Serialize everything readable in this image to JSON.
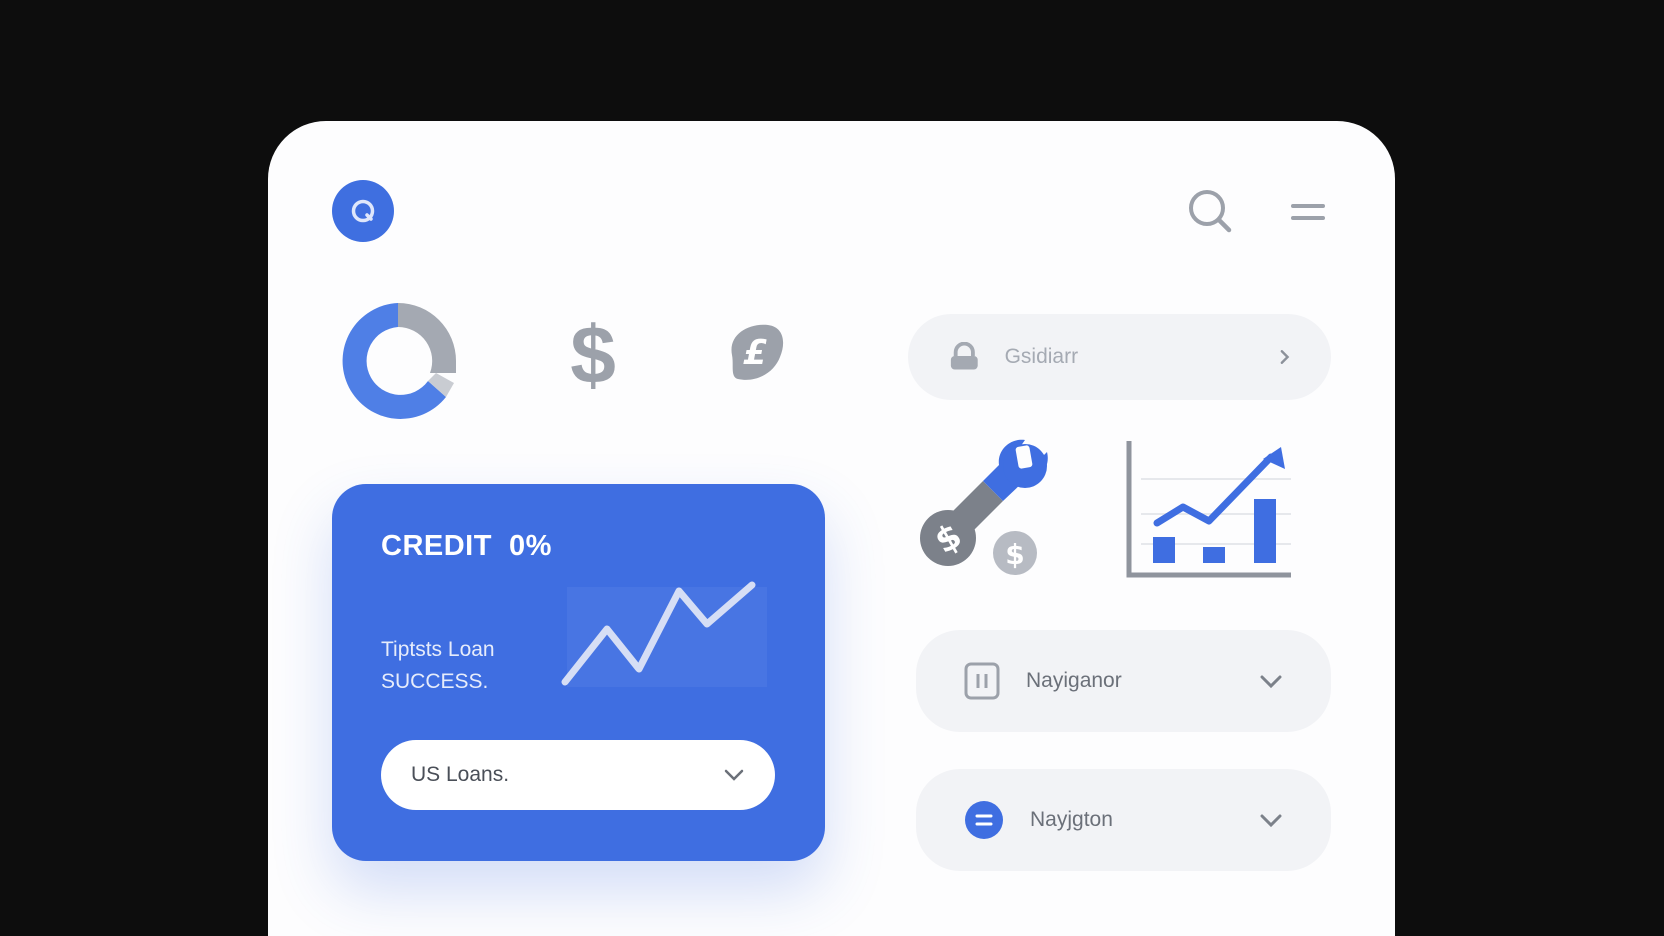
{
  "colors": {
    "accent": "#3f6fe0",
    "background": "#0d0d0d",
    "panel": "#fdfdfe",
    "pill": "#f2f3f6",
    "muted_icon": "#9ca1aa"
  },
  "header": {
    "logo_icon": "search-circle-icon",
    "search_icon": "search-icon",
    "menu_icon": "hamburger-menu-icon"
  },
  "top_icons": {
    "donut": "donut-chart-icon",
    "dollar": "$",
    "pound": "pound-badge-icon"
  },
  "credit_card": {
    "title": "CREDIT  0%",
    "subtitle_line1": "Tiptsts Loan",
    "subtitle_line2": "SUCCESS.",
    "chart_icon": "trend-line-icon",
    "select_label": "US Loans.",
    "select_icon": "chevron-down-icon"
  },
  "search_pill": {
    "placeholder": "Gsidiarr",
    "icon": "lock-icon",
    "arrow_icon": "chevron-right-icon"
  },
  "illustrations": {
    "left": "wrench-dollar-icon",
    "right": "growth-bar-chart-icon"
  },
  "nav_items": [
    {
      "label": "Nayiganor",
      "icon": "pause-square-icon",
      "chevron": "chevron-down-icon"
    },
    {
      "label": "Nayjgton",
      "icon": "equals-circle-icon",
      "chevron": "chevron-down-icon"
    }
  ]
}
